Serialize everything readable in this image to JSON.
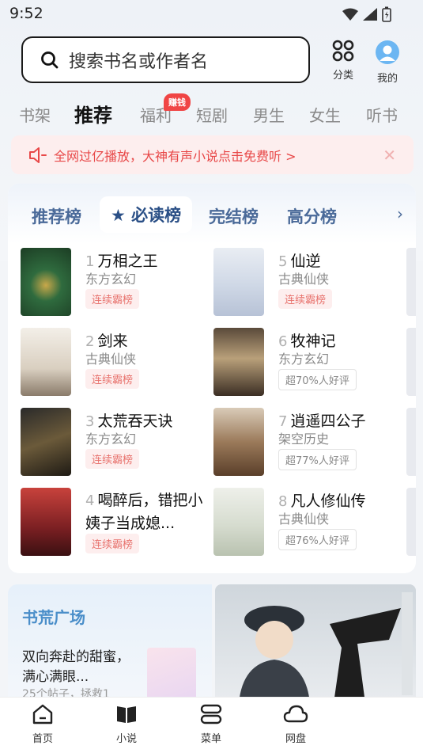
{
  "status": {
    "time": "9:52"
  },
  "search": {
    "placeholder": "搜索书名或作者名"
  },
  "top_actions": {
    "category_label": "分类",
    "mine_label": "我的"
  },
  "tabs": [
    {
      "label": "书架",
      "active": false
    },
    {
      "label": "推荐",
      "active": true
    },
    {
      "label": "福利",
      "active": false,
      "badge": "赚钱"
    },
    {
      "label": "短剧",
      "active": false
    },
    {
      "label": "男生",
      "active": false
    },
    {
      "label": "女生",
      "active": false
    },
    {
      "label": "听书",
      "active": false
    }
  ],
  "notice": {
    "text": "全网过亿播放，大神有声小说点击免费听 >",
    "close_glyph": "✕"
  },
  "ranking": {
    "tabs": [
      {
        "label": "推荐榜",
        "active": false
      },
      {
        "label": "必读榜",
        "active": true
      },
      {
        "label": "完结榜",
        "active": false
      },
      {
        "label": "高分榜",
        "active": false
      }
    ],
    "books": [
      {
        "rank": "1",
        "title": "万相之王",
        "genre": "东方玄幻",
        "tag": "连续霸榜",
        "tag_style": "red"
      },
      {
        "rank": "2",
        "title": "剑来",
        "genre": "古典仙侠",
        "tag": "连续霸榜",
        "tag_style": "red"
      },
      {
        "rank": "3",
        "title": "太荒吞天诀",
        "genre": "东方玄幻",
        "tag": "连续霸榜",
        "tag_style": "red"
      },
      {
        "rank": "4",
        "title": "喝醉后，错把小姨子当成媳...",
        "genre": "",
        "tag": "连续霸榜",
        "tag_style": "red"
      },
      {
        "rank": "5",
        "title": "仙逆",
        "genre": "古典仙侠",
        "tag": "连续霸榜",
        "tag_style": "red"
      },
      {
        "rank": "6",
        "title": "牧神记",
        "genre": "东方玄幻",
        "tag": "超70%人好评",
        "tag_style": "grey"
      },
      {
        "rank": "7",
        "title": "逍遥四公子",
        "genre": "架空历史",
        "tag": "超77%人好评",
        "tag_style": "grey"
      },
      {
        "rank": "8",
        "title": "凡人修仙传",
        "genre": "古典仙侠",
        "tag": "超76%人好评",
        "tag_style": "grey"
      }
    ],
    "next_glyph": "›"
  },
  "plaza": {
    "title": "书荒广场",
    "post": "双向奔赴的甜蜜，满心满眼...",
    "meta": "25个帖子，拯救1"
  },
  "bottom_nav": [
    {
      "label": "首页"
    },
    {
      "label": "小说"
    },
    {
      "label": "菜单"
    },
    {
      "label": "网盘"
    }
  ],
  "colors": {
    "accent_red": "#e84848",
    "rank_blue": "#2a4f86",
    "plaza_blue": "#4a8ec9"
  }
}
